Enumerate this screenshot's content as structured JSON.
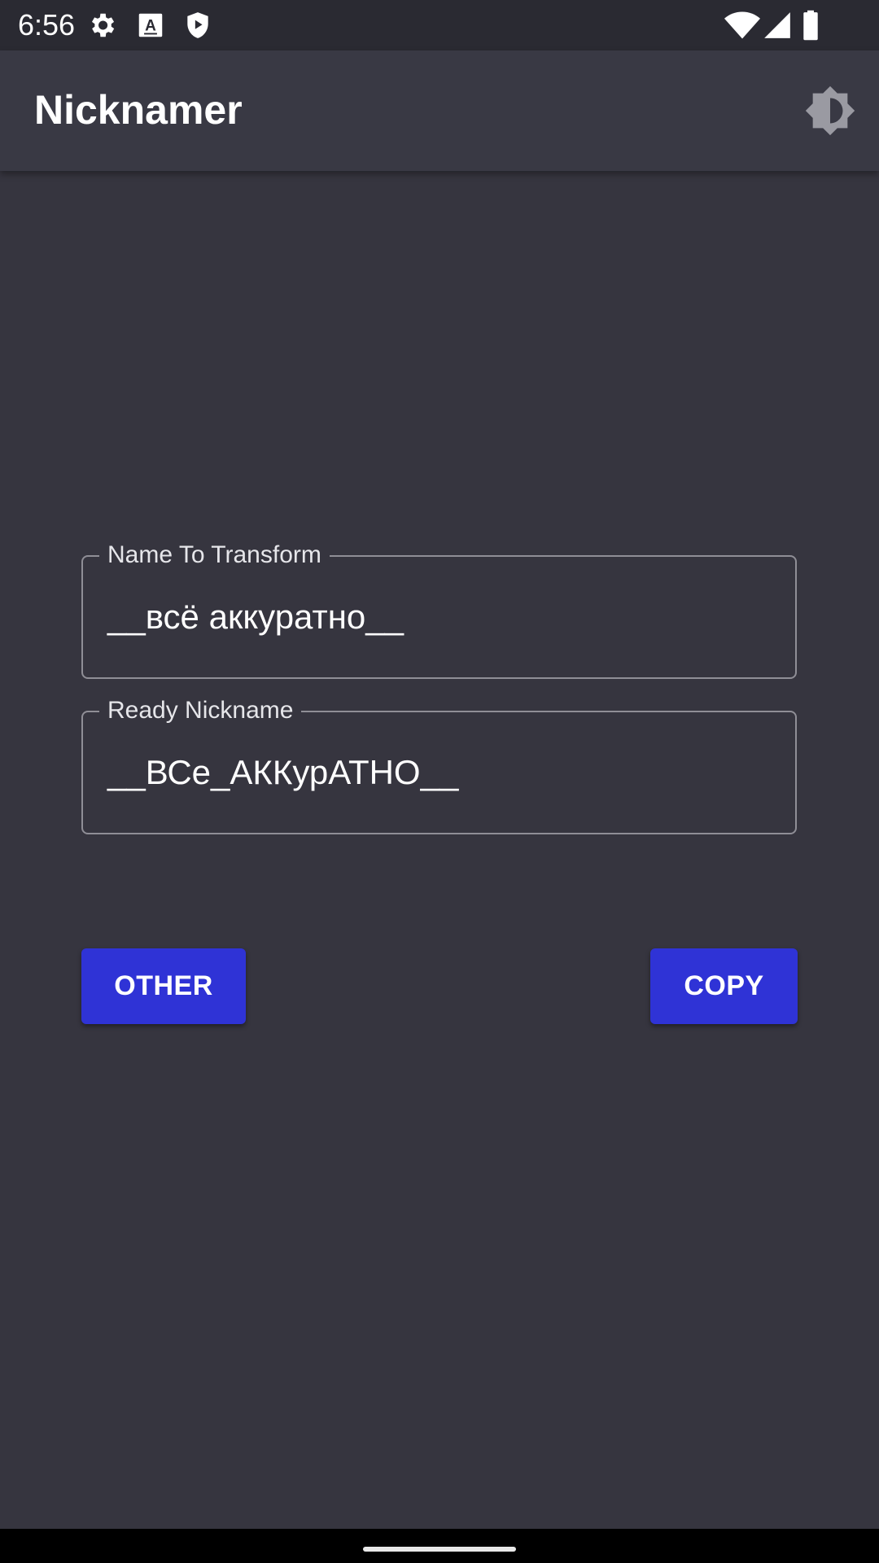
{
  "status_bar": {
    "time": "6:56",
    "left_icons": [
      "gear-icon",
      "font-a-icon",
      "shield-play-icon"
    ],
    "right_icons": [
      "wifi-icon",
      "signal-icon",
      "battery-icon"
    ]
  },
  "app_bar": {
    "title": "Nicknamer",
    "action_icon": "brightness-icon"
  },
  "form": {
    "input_label": "Name To Transform",
    "input_value": "__всё аккуратно__",
    "output_label": "Ready Nickname",
    "output_value": "__ВСе_АККурАТНО__"
  },
  "buttons": {
    "other_label": "OTHER",
    "copy_label": "COPY"
  },
  "colors": {
    "background": "#36353f",
    "app_bar": "#393944",
    "status_bar": "#2a2a32",
    "button": "#2f33d6",
    "outline": "#8f8e96"
  }
}
